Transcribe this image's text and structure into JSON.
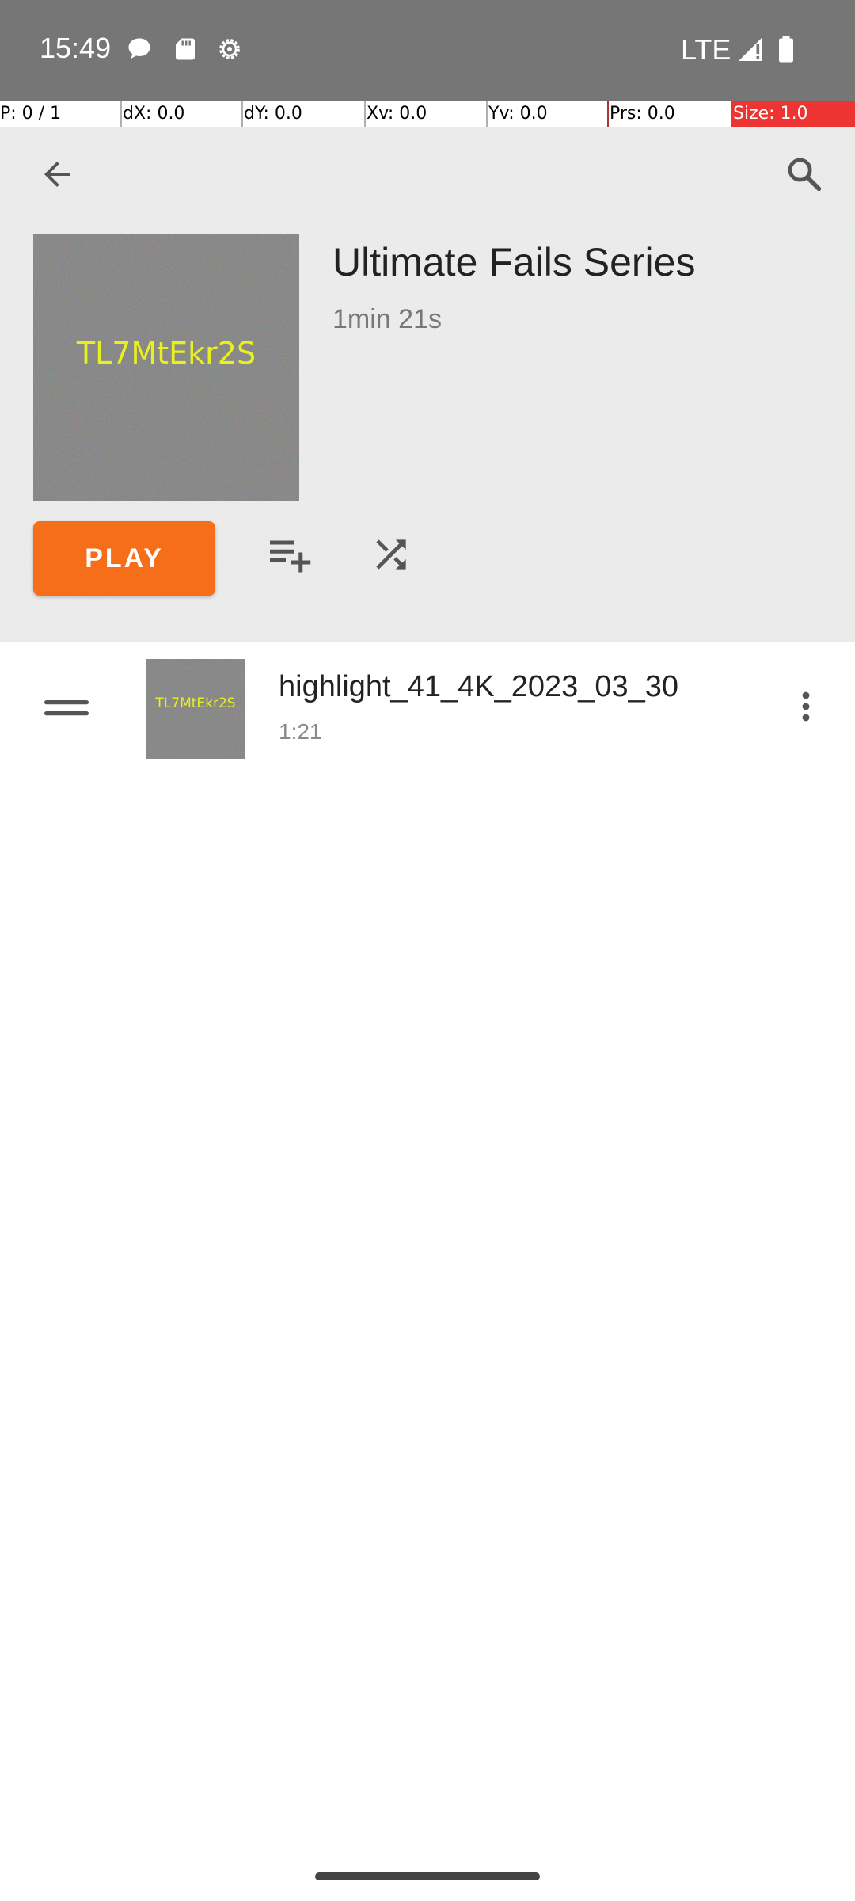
{
  "status_bar": {
    "time": "15:49",
    "network": "LTE",
    "icons": [
      "chat-bubble-icon",
      "sd-card-icon",
      "settings-gear-icon",
      "signal-icon",
      "battery-icon"
    ]
  },
  "pointer_overlay": {
    "pointer": "P: 0 / 1",
    "dx": "dX: 0.0",
    "dy": "dY: 0.0",
    "xv": "Xv: 0.0",
    "yv": "Yv: 0.0",
    "prs": "Prs: 0.0",
    "size": "Size: 1.0"
  },
  "header": {
    "title": "Ultimate Fails Series",
    "duration": "1min 21s",
    "cover_code": "TL7MtEkr2S",
    "play_label": "PLAY",
    "icons": [
      "back-arrow-icon",
      "search-icon",
      "add-to-queue-icon",
      "shuffle-icon"
    ]
  },
  "tracks": [
    {
      "title": "highlight_41_4K_2023_03_30",
      "duration": "1:21",
      "thumb_code": "TL7MtEkr2S"
    }
  ],
  "colors": {
    "accent": "#f66e1a",
    "status_bar": "#767676",
    "overlay_size_bg": "#ee3333",
    "cover_text": "#e8f020"
  }
}
